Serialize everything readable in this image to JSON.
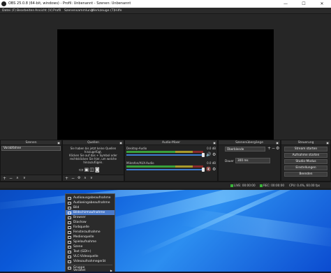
{
  "window": {
    "title": "OBS 25.0.8 (64-bit, windows) - Profil: Unbenannt - Szenen: Unbenannt",
    "controls": [
      "—",
      "☐",
      "✕"
    ]
  },
  "menubar": [
    "Datei (F)",
    "Bearbeiten",
    "Ansicht (V)",
    "Profil",
    "Szenensammlung",
    "Werkzeuge (T)",
    "Hilfe"
  ],
  "docks": {
    "scenes": {
      "title": "Szenen",
      "items": [
        "Vorabfahne"
      ]
    },
    "sources": {
      "title": "Quellen",
      "empty_msg": [
        "Sie haben bis jetzt keine Quellen",
        "hinzugefügt.",
        "Klicken Sie auf das + Symbol oder",
        "rechtsklicken Sie hier, um welche",
        "hinzuzufügen."
      ]
    },
    "mixer": {
      "title": "Audio-Mixer",
      "tracks": [
        {
          "name": "Desktop-Audio",
          "db": "0.0 dB"
        },
        {
          "name": "Mikrofon/AUX-Audio",
          "db": "0.0 dB"
        }
      ]
    },
    "transitions": {
      "title": "Szenenübergänge",
      "selected": "Überblende",
      "duration_label": "Dauer",
      "duration_value": "300 ms"
    },
    "controls": {
      "title": "Steuerung",
      "buttons": [
        "Stream starten",
        "Aufnahme starten",
        "Studio-Modus",
        "Einstellungen",
        "Beenden"
      ]
    }
  },
  "statusbar": {
    "live": "LIVE: 00:00:00",
    "rec": "REC: 00:00:00",
    "cpu": "CPU: 0.4%, 60.00 fps"
  },
  "context_menu": {
    "items": [
      "Audioausgabeaufnahme",
      "Audioeingabeaufnahme",
      "Bild",
      "Bildschirmaufnahme",
      "Browser",
      "Diashow",
      "Farbquelle",
      "Fensteraufnahme",
      "Medienquelle",
      "Spielaufnahme",
      "Szene",
      "Text (GDI+)",
      "VLC-Videoquelle",
      "Videoaufnahmegerät",
      "Gruppe",
      "Veraltet"
    ],
    "highlighted_index": 3,
    "submenu_arrow": "▶"
  },
  "colors": {
    "accent_highlight": "#4a79c8",
    "obs_bg": "#1f1f1f",
    "desktop_blue": "#0a58d8"
  }
}
